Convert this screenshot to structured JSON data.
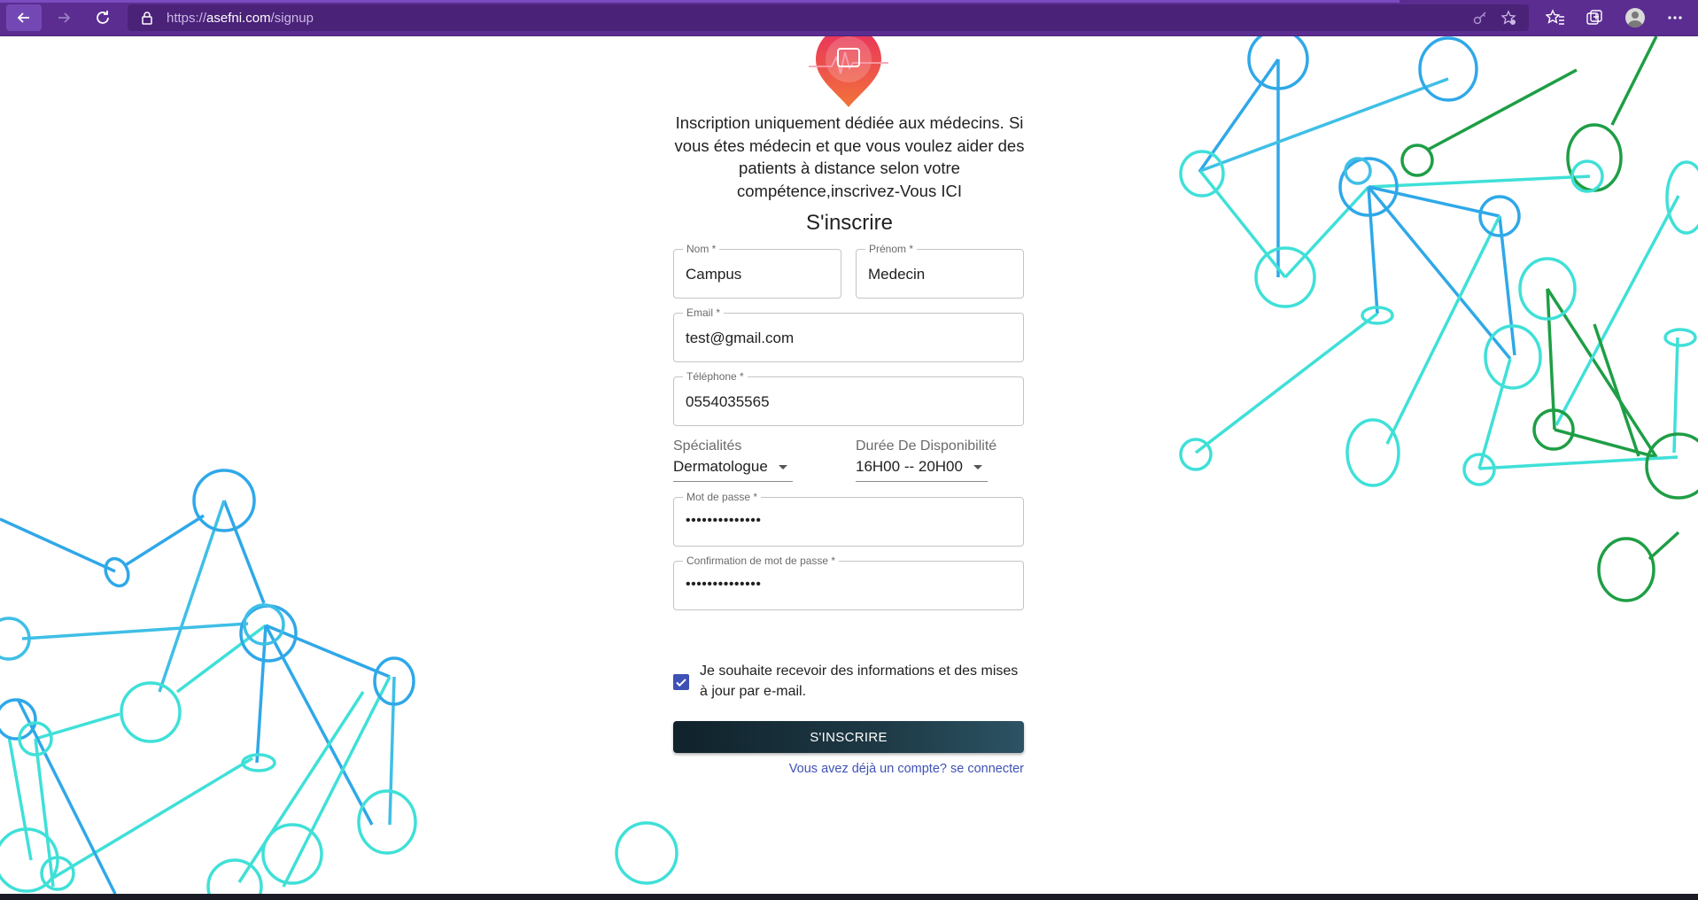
{
  "browser": {
    "url_prefix": "https://",
    "url_host": "asefni.com",
    "url_path": "/signup"
  },
  "intro_text": "Inscription uniquement dédiée aux médecins. Si vous étes médecin et que vous voulez aider des patients à distance selon votre compétence,inscrivez-Vous ICI",
  "form": {
    "title": "S'inscrire",
    "nom": {
      "label": "Nom *",
      "value": "Campus"
    },
    "prenom": {
      "label": "Prénom *",
      "value": "Medecin"
    },
    "email": {
      "label": "Email *",
      "value": "test@gmail.com"
    },
    "telephone": {
      "label": "Téléphone *",
      "value": "0554035565"
    },
    "specialites": {
      "label": "Spécialités",
      "value": "Dermatologue"
    },
    "disponibilite": {
      "label": "Durée De Disponibilité",
      "value": "16H00 -- 20H00"
    },
    "password": {
      "label": "Mot de passe *",
      "value": "••••••••••••••"
    },
    "password_confirm": {
      "label": "Confirmation de mot de passe *",
      "value": "••••••••••••••"
    },
    "newsletter_label": "Je souhaite recevoir des informations et des mises à jour par e-mail.",
    "newsletter_checked": true,
    "submit_label": "S'INSCRIRE",
    "login_link": "Vous avez déjà un compte? se connecter"
  },
  "colors": {
    "browser_bar": "#5b2d91",
    "accent": "#3f51b5",
    "button_dark": "#10222b",
    "button_light": "#2c5364",
    "network_blue": "#2fa8e8",
    "network_cyan": "#3fe0d8",
    "network_green": "#1e9e45"
  }
}
